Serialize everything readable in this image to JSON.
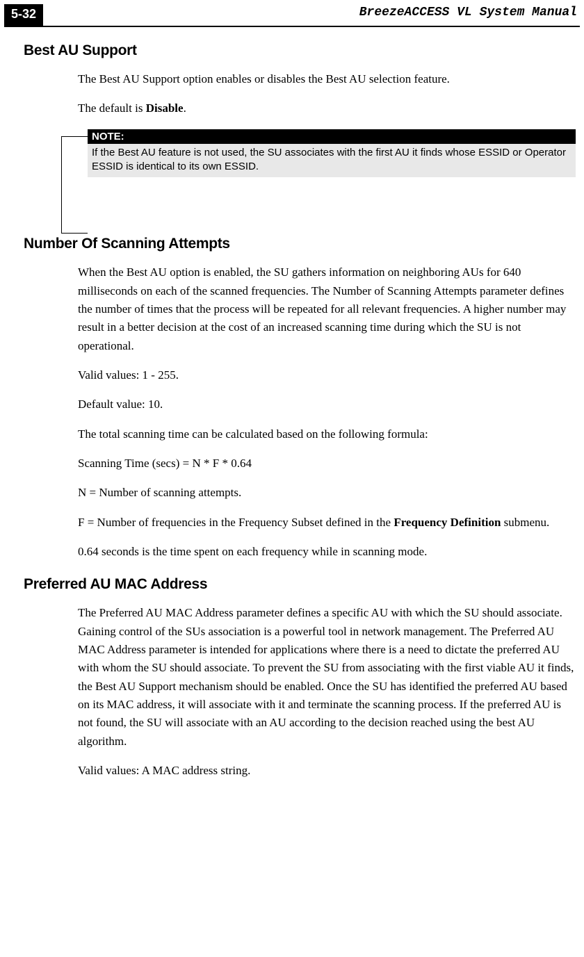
{
  "header": {
    "page_number": "5-32",
    "manual_title": "BreezeACCESS VL System Manual"
  },
  "section1": {
    "heading": "Best AU Support",
    "p1": "The Best AU Support option enables or disables the Best AU selection feature.",
    "p2_pre": "The default is ",
    "p2_bold": "Disable",
    "p2_post": "."
  },
  "note": {
    "label": "NOTE:",
    "body": "If the Best AU feature is not used, the SU associates with the first AU it finds whose ESSID or Operator ESSID is identical to its own ESSID."
  },
  "section2": {
    "heading": "Number Of Scanning Attempts",
    "p1": "When the Best AU option is enabled, the SU gathers information on neighboring AUs for 640 milliseconds on each of the scanned frequencies. The Number of Scanning Attempts parameter defines the number of times that the process will be repeated for all relevant frequencies.  A higher number may result in a better decision at the cost of an increased scanning time during which the SU is not operational.",
    "p2": "Valid values: 1 - 255.",
    "p3": "Default value: 10.",
    "p4": "The total scanning time can be calculated based on the following formula:",
    "p5": "Scanning Time (secs) = N * F * 0.64",
    "p6": "N = Number of scanning attempts.",
    "p7_pre": "F = Number of frequencies in the Frequency Subset defined in the ",
    "p7_bold": "Frequency Definition",
    "p7_post": " submenu.",
    "p8": "0.64 seconds is the time spent on each frequency while in scanning mode."
  },
  "section3": {
    "heading": "Preferred AU MAC Address",
    "p1": "The Preferred AU MAC Address parameter defines a specific AU with which the SU should associate. Gaining control of the SUs association is a powerful tool in network management. The Preferred AU MAC Address parameter is intended for applications where there is a need to dictate the preferred AU with whom the SU should associate. To prevent the SU from associating with the first viable AU it finds, the Best AU Support mechanism should be enabled. Once the SU has identified the preferred AU based on its MAC address, it will associate with it and terminate the scanning process. If the preferred AU is not found, the SU will associate with an AU according to the decision reached using the best AU algorithm.",
    "p2": "Valid values: A MAC address string."
  }
}
